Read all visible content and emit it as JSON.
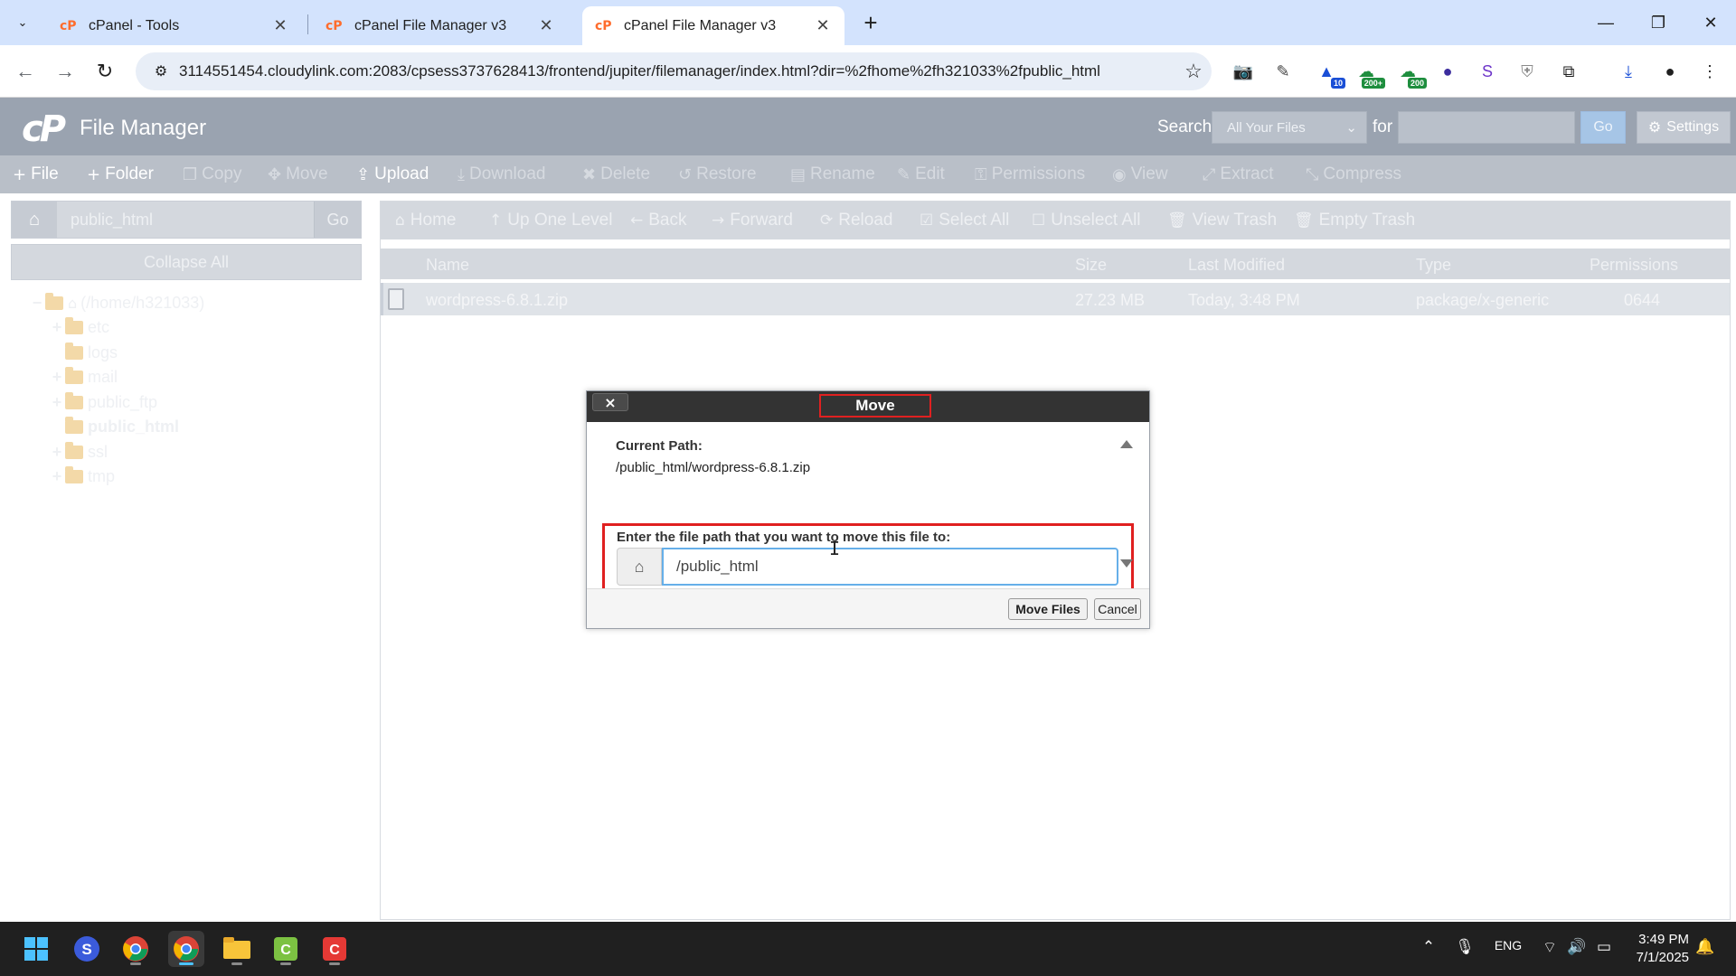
{
  "browser": {
    "tabs": [
      {
        "title": "cPanel - Tools",
        "active": false
      },
      {
        "title": "cPanel File Manager v3",
        "active": false
      },
      {
        "title": "cPanel File Manager v3",
        "active": true
      }
    ],
    "url": "3114551454.cloudylink.com:2083/cpsess3737628413/frontend/jupiter/filemanager/index.html?dir=%2fhome%2fh321033%2fpublic_html",
    "extension_badges": [
      "10",
      "200+",
      "200"
    ]
  },
  "header": {
    "logo": "cP",
    "title": "File Manager",
    "search_label": "Search",
    "search_scope": "All Your Files",
    "for_label": "for",
    "go_label": "Go",
    "settings_label": "Settings"
  },
  "actions": [
    {
      "label": "File",
      "icon": "+",
      "enabled": true
    },
    {
      "label": "Folder",
      "icon": "+",
      "enabled": true
    },
    {
      "label": "Copy",
      "icon": "❐",
      "enabled": false
    },
    {
      "label": "Move",
      "icon": "✥",
      "enabled": false
    },
    {
      "label": "Upload",
      "icon": "⇪",
      "enabled": true
    },
    {
      "label": "Download",
      "icon": "⤓",
      "enabled": false
    },
    {
      "label": "Delete",
      "icon": "✖",
      "enabled": false
    },
    {
      "label": "Restore",
      "icon": "↺",
      "enabled": false
    },
    {
      "label": "Rename",
      "icon": "▤",
      "enabled": false
    },
    {
      "label": "Edit",
      "icon": "✎",
      "enabled": false
    },
    {
      "label": "Permissions",
      "icon": "⚿",
      "enabled": false
    },
    {
      "label": "View",
      "icon": "◉",
      "enabled": false
    },
    {
      "label": "Extract",
      "icon": "⤢",
      "enabled": false
    },
    {
      "label": "Compress",
      "icon": "⤡",
      "enabled": false
    }
  ],
  "sidebar": {
    "path_value": "public_html",
    "go_label": "Go",
    "collapse_label": "Collapse All",
    "tree": [
      {
        "label": "(/home/h321033)",
        "toggle": "−",
        "level": 0,
        "home": true
      },
      {
        "label": "etc",
        "toggle": "+",
        "level": 1
      },
      {
        "label": "logs",
        "toggle": "",
        "level": 1
      },
      {
        "label": "mail",
        "toggle": "+",
        "level": 1
      },
      {
        "label": "public_ftp",
        "toggle": "+",
        "level": 1
      },
      {
        "label": "public_html",
        "toggle": "",
        "level": 1,
        "bold": true
      },
      {
        "label": "ssl",
        "toggle": "+",
        "level": 1
      },
      {
        "label": "tmp",
        "toggle": "+",
        "level": 1
      }
    ]
  },
  "navbar": [
    {
      "label": "Home",
      "icon": "⌂"
    },
    {
      "label": "Up One Level",
      "icon": "↑"
    },
    {
      "label": "Back",
      "icon": "←"
    },
    {
      "label": "Forward",
      "icon": "→"
    },
    {
      "label": "Reload",
      "icon": "⟳"
    },
    {
      "label": "Select All",
      "icon": "☑"
    },
    {
      "label": "Unselect All",
      "icon": "☐"
    },
    {
      "label": "View Trash",
      "icon": "🗑"
    },
    {
      "label": "Empty Trash",
      "icon": "🗑"
    }
  ],
  "table": {
    "columns": [
      "Name",
      "Size",
      "Last Modified",
      "Type",
      "Permissions"
    ],
    "rows": [
      {
        "name": "wordpress-6.8.1.zip",
        "size": "27.23 MB",
        "modified": "Today, 3:48 PM",
        "type": "package/x-generic",
        "perms": "0644"
      }
    ]
  },
  "dialog": {
    "close_label": "×",
    "title": "Move",
    "current_path_label": "Current Path:",
    "current_path_value": "/public_html/wordpress-6.8.1.zip",
    "dest_label": "Enter the file path that you want to move this file to:",
    "dest_value": "/public_html",
    "move_button": "Move Files",
    "cancel_button": "Cancel"
  },
  "taskbar": {
    "lang": "ENG",
    "time": "3:49 PM",
    "date": "7/1/2025"
  },
  "colors": {
    "cpanel_header": "#9aa3b0",
    "dialog_highlight": "#e02020",
    "chrome_tabstrip": "#d3e3fd"
  }
}
